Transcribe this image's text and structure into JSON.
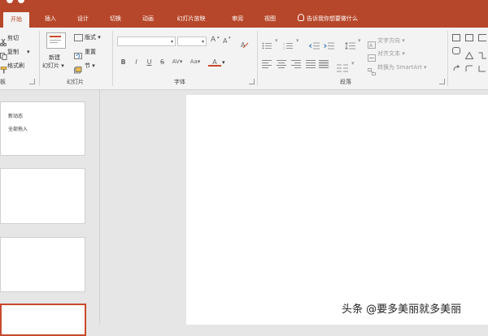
{
  "tabs": [
    {
      "label": "开始"
    },
    {
      "label": "插入"
    },
    {
      "label": "设计"
    },
    {
      "label": "切换"
    },
    {
      "label": "动画"
    },
    {
      "label": "幻灯片放映"
    },
    {
      "label": "审阅"
    },
    {
      "label": "视图"
    }
  ],
  "tell_me": "告诉我你想要做什么",
  "clipboard": {
    "cut": "剪切",
    "copy": "复制",
    "format_painter": "格式刷",
    "group_label": "板"
  },
  "slides_group": {
    "new_slide_line1": "新建",
    "new_slide_line2": "幻灯片",
    "layout": "版式",
    "reset": "重置",
    "section": "节",
    "group_label": "幻灯片"
  },
  "font_group": {
    "font_name": "",
    "font_size": "",
    "grow": "A",
    "shrink": "A",
    "bold": "B",
    "italic": "I",
    "underline": "U",
    "strike": "S",
    "spacing": "AV",
    "case": "Aa",
    "color": "A",
    "group_label": "字体"
  },
  "paragraph_group": {
    "text_direction": "文字方向",
    "align_text": "对齐文本",
    "smartart": "转换为 SmartArt",
    "group_label": "段落"
  },
  "thumbnails": {
    "slide1_line1": "新动态",
    "slide1_line2": "全部拖入"
  },
  "watermark": "头条 @要多美丽就多美丽",
  "colors": {
    "accent": "#b7472a",
    "ribbon": "#f3f3f3",
    "workspace": "#e6e6e6",
    "selection": "#c8482c"
  }
}
